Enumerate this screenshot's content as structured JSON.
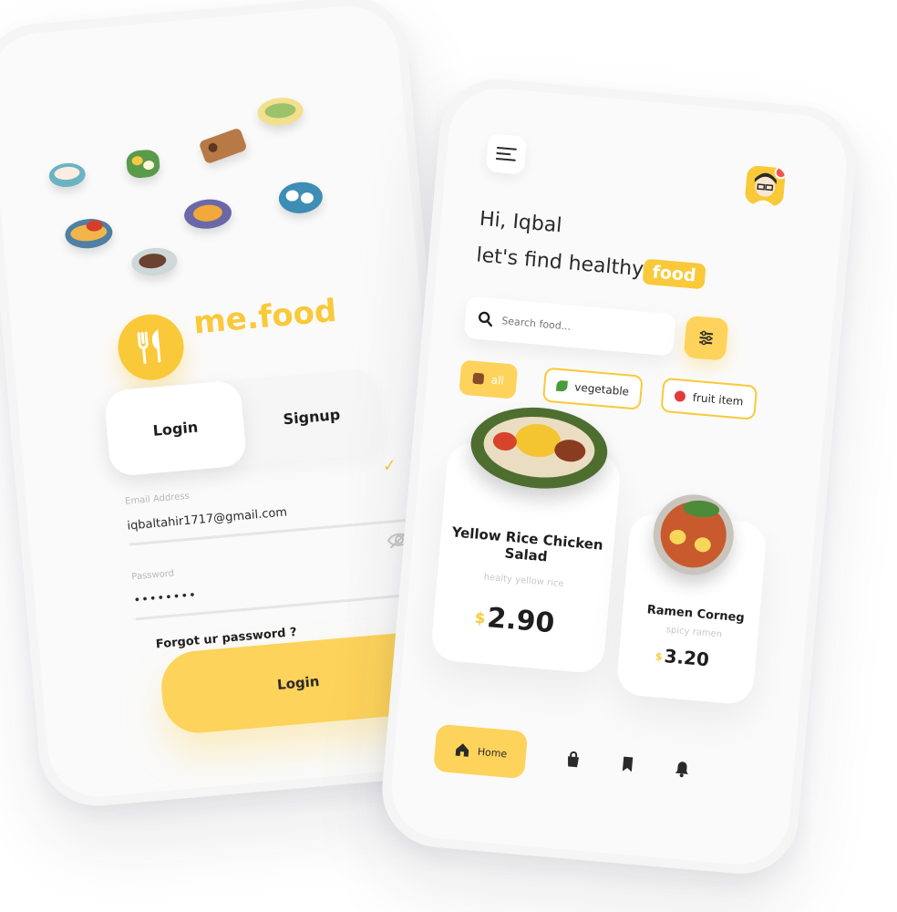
{
  "login_screen": {
    "brand": "me.food",
    "tabs": {
      "login": "Login",
      "signup": "Signup"
    },
    "email": {
      "label": "Email Address",
      "value": "iqbaltahir1717@gmail.com"
    },
    "password": {
      "label": "Password",
      "value": "••••••••"
    },
    "forgot_link": "Forgot ur password ?",
    "login_button": "Login"
  },
  "home_screen": {
    "greeting": "Hi, Iqbal",
    "subtitle": "let's find healthy",
    "subtitle_badge": "food",
    "search": {
      "placeholder": "Search food..."
    },
    "categories": [
      {
        "label": "all",
        "icon": "bento-icon",
        "active": true
      },
      {
        "label": "vegetable",
        "icon": "leaf-icon",
        "active": false
      },
      {
        "label": "fruit item",
        "icon": "strawberry-icon",
        "active": false
      }
    ],
    "cards": [
      {
        "title": "Yellow Rice Chicken Salad",
        "subtitle": "healty yellow rice",
        "currency": "$",
        "price": "2.90"
      },
      {
        "title": "Ramen Corneg",
        "subtitle": "spicy ramen",
        "currency": "$",
        "price": "3.20"
      }
    ],
    "bottom_nav": {
      "home_label": "Home"
    }
  },
  "colors": {
    "accent": "#f9c93a",
    "accent_light": "#fdd35b",
    "notification": "#f0524f"
  }
}
